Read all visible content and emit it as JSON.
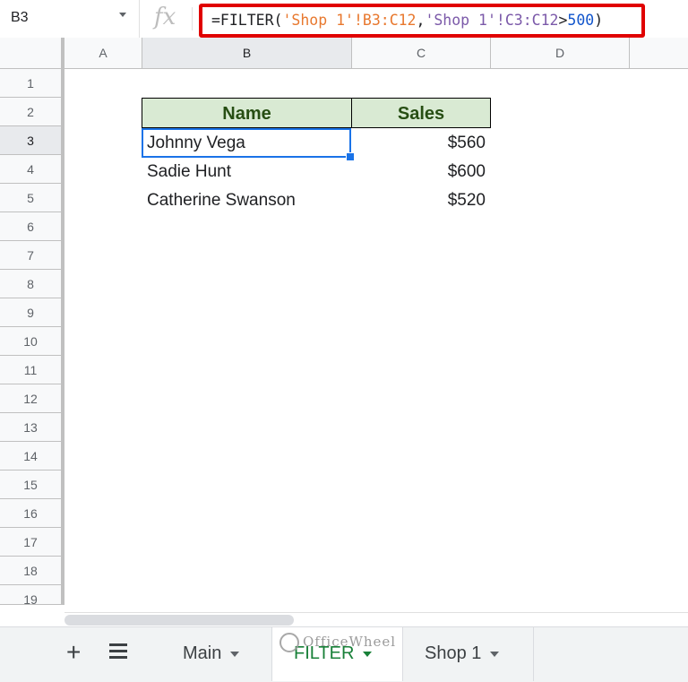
{
  "formula_bar": {
    "name_box": "B3",
    "fx_label": "fx",
    "formula": {
      "prefix": "=FILTER(",
      "range1": "'Shop 1'!B3:C12",
      "comma": ",",
      "range2": "'Shop 1'!C3:C12",
      "op": ">",
      "number": "500",
      "suffix": ")"
    }
  },
  "columns": [
    "A",
    "B",
    "C",
    "D"
  ],
  "rows": [
    "1",
    "2",
    "3",
    "4",
    "5",
    "6",
    "7",
    "8",
    "9",
    "10",
    "11",
    "12",
    "13",
    "14",
    "15",
    "16",
    "17",
    "18",
    "19"
  ],
  "table": {
    "headers": [
      "Name",
      "Sales"
    ],
    "data": [
      {
        "name": "Johnny Vega",
        "sales": "$560"
      },
      {
        "name": "Sadie Hunt",
        "sales": "$600"
      },
      {
        "name": "Catherine Swanson",
        "sales": "$520"
      }
    ]
  },
  "sheet_tabs": {
    "add_label": "+",
    "tabs": [
      {
        "label": "Main",
        "active": false
      },
      {
        "label": "FILTER",
        "active": true
      },
      {
        "label": "Shop 1",
        "active": false
      }
    ]
  },
  "watermark": "OfficeWheel",
  "colors": {
    "header_fill": "#d9ead3",
    "header_text": "#274e13",
    "active_border": "#1a73e8",
    "formula_highlight": "#e00000"
  }
}
